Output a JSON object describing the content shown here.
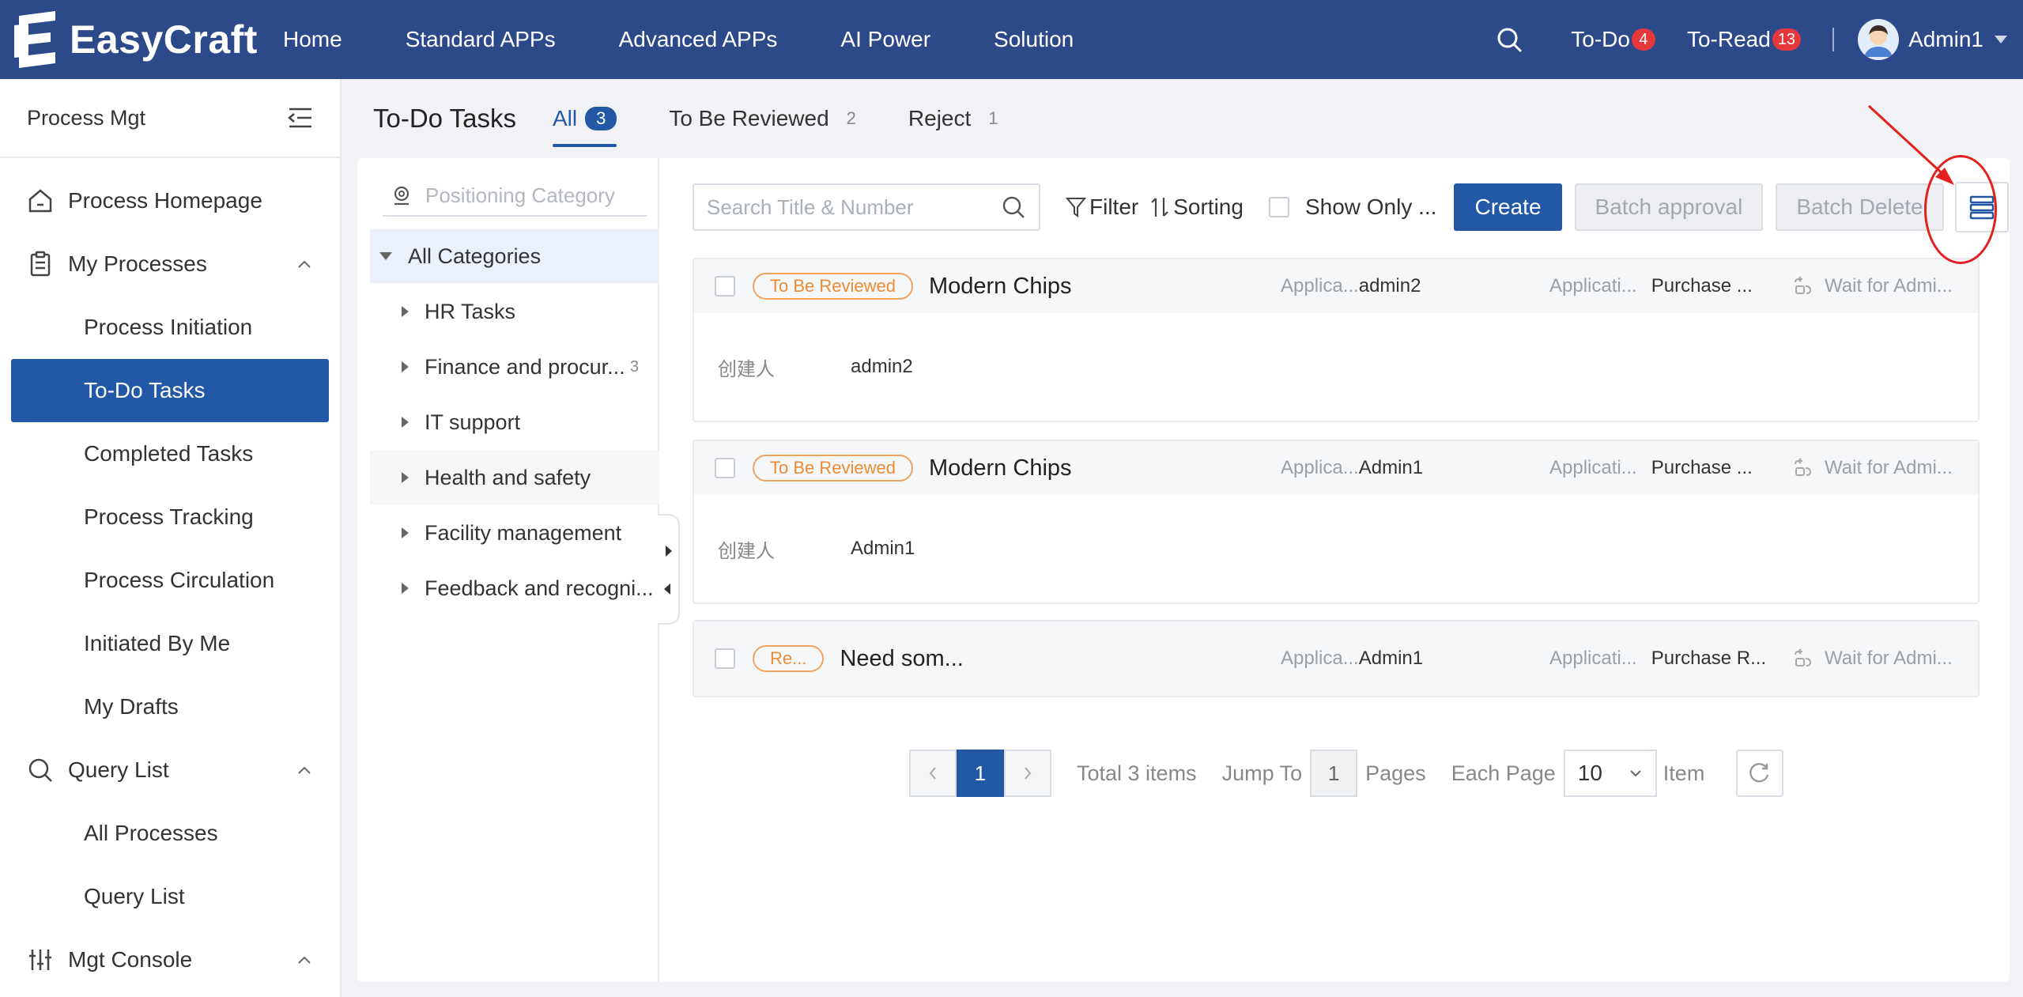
{
  "app": {
    "name": "EasyCraft"
  },
  "topnav": {
    "items": [
      "Home",
      "Standard APPs",
      "Advanced APPs",
      "AI Power",
      "Solution"
    ],
    "todo": {
      "label": "To-Do",
      "count": "4"
    },
    "toread": {
      "label": "To-Read",
      "count": "13"
    },
    "user": "Admin1"
  },
  "sidebar": {
    "title": "Process Mgt",
    "process_homepage": "Process Homepage",
    "my_processes": "My Processes",
    "my_processes_items": [
      "Process Initiation",
      "To-Do Tasks",
      "Completed Tasks",
      "Process Tracking",
      "Process Circulation",
      "Initiated By Me",
      "My Drafts"
    ],
    "query_list": "Query List",
    "query_items": [
      "All Processes",
      "Query List"
    ],
    "mgt_console": "Mgt Console",
    "active_item": "To-Do Tasks"
  },
  "page": {
    "title": "To-Do Tasks",
    "tabs": [
      {
        "label": "All",
        "count": "3"
      },
      {
        "label": "To Be Reviewed",
        "count": "2"
      },
      {
        "label": "Reject",
        "count": "1"
      }
    ]
  },
  "categories": {
    "search_placeholder": "Positioning Category",
    "all": "All Categories",
    "items": [
      {
        "label": "HR Tasks",
        "count": ""
      },
      {
        "label": "Finance and procur...",
        "count": "3"
      },
      {
        "label": "IT support",
        "count": ""
      },
      {
        "label": "Health and safety",
        "count": ""
      },
      {
        "label": "Facility management",
        "count": ""
      },
      {
        "label": "Feedback and recogni...",
        "count": ""
      }
    ]
  },
  "toolbar": {
    "search_placeholder": "Search Title & Number",
    "filter": "Filter",
    "sorting": "Sorting",
    "show_only": "Show Only ...",
    "create": "Create",
    "batch_approval": "Batch approval",
    "batch_delete": "Batch Delete"
  },
  "cards": [
    {
      "status": "To Be Reviewed",
      "title": "Modern Chips",
      "applicant_label": "Applica...",
      "applicant": "admin2",
      "app_label": "Applicati...",
      "app": "Purchase ...",
      "wait": "Wait for Admi...",
      "creator_label": "创建人",
      "creator": "admin2"
    },
    {
      "status": "To Be Reviewed",
      "title": "Modern Chips",
      "applicant_label": "Applica...",
      "applicant": "Admin1",
      "app_label": "Applicati...",
      "app": "Purchase ...",
      "wait": "Wait for Admi...",
      "creator_label": "创建人",
      "creator": "Admin1"
    },
    {
      "status": "Re...",
      "title": "Need som...",
      "applicant_label": "Applica...",
      "applicant": "Admin1",
      "app_label": "Applicati...",
      "app": "Purchase R...",
      "wait": "Wait for Admi..."
    }
  ],
  "pager": {
    "current": "1",
    "total": "Total 3 items",
    "jump_label": "Jump To",
    "jump_value": "1",
    "pages_label": "Pages",
    "each_page": "Each Page",
    "page_size": "10",
    "item_label": "Item"
  },
  "colors": {
    "topbar": "#2c4a8a",
    "accent": "#2358a6",
    "warning": "#ed8b34",
    "badge": "#e5383b",
    "annotation": "#e3201b"
  }
}
